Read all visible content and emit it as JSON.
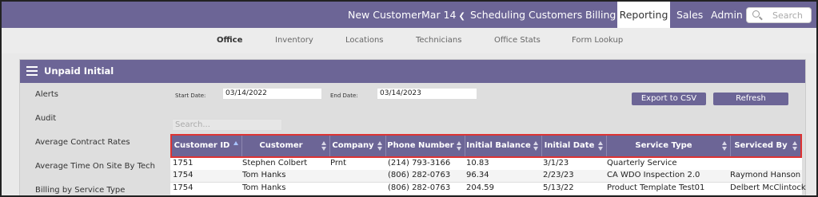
{
  "nav": {
    "items": [
      "New Customer",
      "Mar 14",
      "Scheduling",
      "Customers",
      "Billing",
      "Reporting",
      "Sales",
      "Admin"
    ],
    "active": "Reporting",
    "search_placeholder": "Search"
  },
  "subnav": {
    "items": [
      "Office",
      "Inventory",
      "Locations",
      "Technicians",
      "Office Stats",
      "Form Lookup"
    ],
    "active": "Office"
  },
  "panel": {
    "title": "Unpaid Initial",
    "menu": [
      "Alerts",
      "Audit",
      "Average Contract Rates",
      "Average Time On Site By Tech",
      "Billing by Service Type"
    ]
  },
  "filters": {
    "start_label": "Start Date:",
    "start_value": "03/14/2022",
    "end_label": "End Date:",
    "end_value": "03/14/2023",
    "export_label": "Export to CSV",
    "refresh_label": "Refresh",
    "table_search_placeholder": "Search..."
  },
  "table": {
    "columns": [
      "Customer ID",
      "Customer",
      "Company",
      "Phone Number",
      "Initial Balance",
      "Initial Date",
      "Service Type",
      "Serviced By"
    ],
    "rows": [
      [
        "1751",
        "Stephen Colbert",
        "Prnt",
        "(214) 793-3166",
        "10.83",
        "3/1/23",
        "Quarterly Service",
        ""
      ],
      [
        "1754",
        "Tom Hanks",
        "",
        "(806) 282-0763",
        "96.34",
        "2/23/23",
        "CA WDO Inspection 2.0",
        "Raymond Hanson"
      ],
      [
        "1754",
        "Tom Hanks",
        "",
        "(806) 282-0763",
        "204.59",
        "5/13/22",
        "Product Template Test01",
        "Delbert McClintock"
      ]
    ]
  },
  "colors": {
    "brand": "#6c6596",
    "highlight": "#dd3333"
  }
}
